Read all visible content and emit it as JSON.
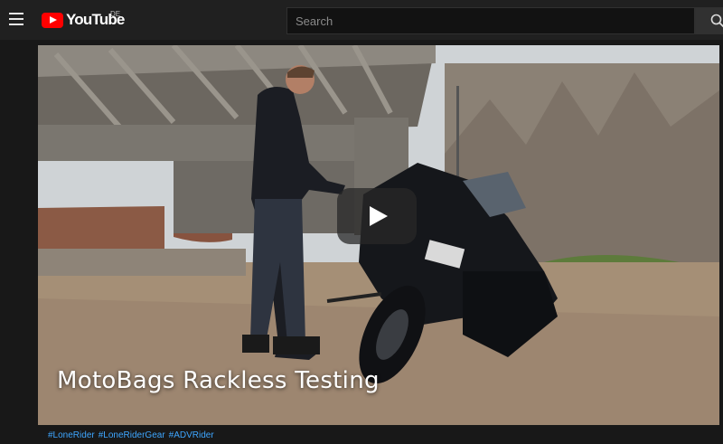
{
  "header": {
    "logo_text": "YouTube",
    "country_code": "DE",
    "search_placeholder": "Search"
  },
  "video": {
    "overlay_title": "MotoBags Rackless Testing"
  },
  "hashtags": [
    "#LoneRider",
    "#LoneRiderGear",
    "#ADVRider"
  ],
  "colors": {
    "brand_red": "#ff0000",
    "link_blue": "#3ea6ff",
    "background": "#181818",
    "masthead": "#202020"
  },
  "icons": {
    "menu": "hamburger-menu-icon",
    "logo": "youtube-logo-icon",
    "search": "search-icon",
    "play": "play-icon"
  }
}
